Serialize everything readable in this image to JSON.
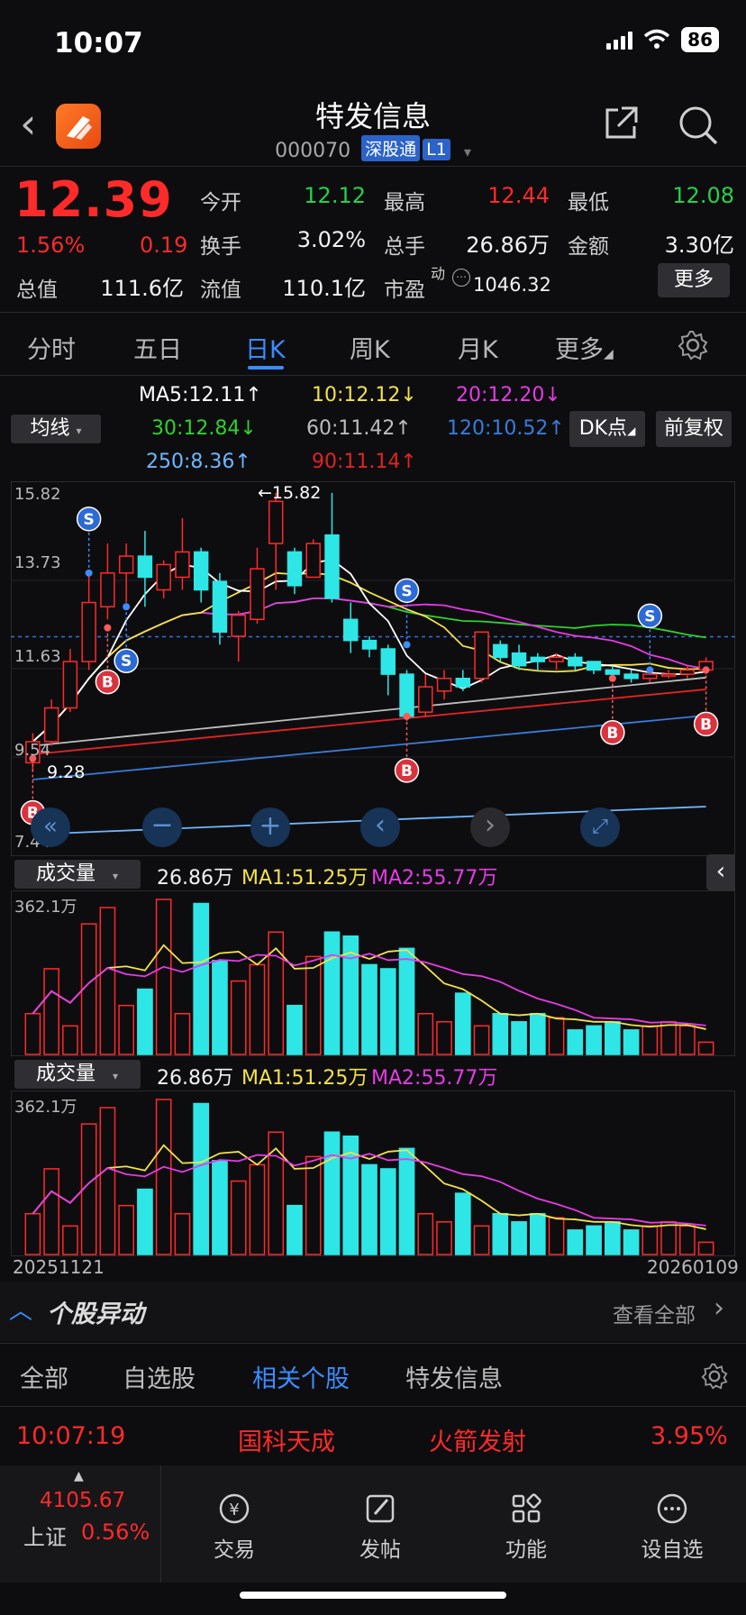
{
  "status": {
    "time": "10:07",
    "battery": "86"
  },
  "header": {
    "title": "特发信息",
    "code": "000070",
    "tag1": "深股通",
    "tag2": "L1"
  },
  "quote": {
    "price": "12.39",
    "change_pct": "1.56%",
    "change": "0.19",
    "open_label": "今开",
    "open": "12.12",
    "high_label": "最高",
    "high": "12.44",
    "low_label": "最低",
    "low": "12.08",
    "turnover_label": "换手",
    "turnover": "3.02%",
    "volume_label": "总手",
    "volume": "26.86万",
    "amount_label": "金额",
    "amount": "3.30亿",
    "mktcap_label": "总值",
    "mktcap": "111.6亿",
    "float_label": "流值",
    "float": "110.1亿",
    "pe_label": "市盈",
    "pe_sup": "动",
    "pe": "1046.32",
    "more_label": "更多"
  },
  "tabs": [
    "分时",
    "五日",
    "日K",
    "周K",
    "月K",
    "更多"
  ],
  "ma_legend": {
    "selector": "均线",
    "ma5": "MA5:12.11↑",
    "ma10": "10:12.12↓",
    "ma20": "20:12.20↓",
    "ma30": "30:12.84↓",
    "ma60": "60:11.42↑",
    "ma120": "120:10.52↑",
    "ma250": "250:8.36↑",
    "ma90": "90:11.14↑",
    "dk_label": "DK点",
    "fq_label": "前复权"
  },
  "kline": {
    "y_labels": [
      "15.82",
      "13.73",
      "11.63",
      "9.54",
      "7.44"
    ],
    "max_label": "←15.82",
    "min_label": "9.28",
    "marker_b": "B",
    "marker_s": "S"
  },
  "volume1": {
    "selector": "成交量",
    "value": "26.86万",
    "ma1": "MA1:51.25万",
    "ma2": "MA2:55.77万",
    "top_label": "362.1万"
  },
  "volume2": {
    "selector": "成交量",
    "value": "26.86万",
    "ma1": "MA1:51.25万",
    "ma2": "MA2:55.77万",
    "top_label": "362.1万",
    "date_start": "20251121",
    "date_end": "20260109"
  },
  "abnormal": {
    "title": "个股异动",
    "view_all": "查看全部"
  },
  "sub_tabs": [
    "全部",
    "自选股",
    "相关个股",
    "特发信息"
  ],
  "alert": {
    "time": "10:07:19",
    "stock": "国科天成",
    "event": "火箭发射",
    "pct": "3.95%"
  },
  "bottom_bar": {
    "index_value": "4105.67",
    "index_name": "上证",
    "index_pct": "0.56%",
    "items": [
      "交易",
      "发帖",
      "功能",
      "设自选"
    ]
  },
  "colors": {
    "up": "#ff2a2a",
    "down": "#26d14b",
    "accent": "#3b8cff",
    "candle_down": "#2ee6e6",
    "ma5": "#ffffff",
    "ma10": "#f2e24a",
    "ma20": "#e63be6",
    "ma30": "#2fd12f",
    "ma60": "#bdbdbd",
    "ma90": "#e02424",
    "ma120": "#3a7bd9",
    "ma250": "#6fb6ff"
  },
  "chart_data": {
    "type": "candlestick",
    "ylim": [
      7.44,
      15.82
    ],
    "candles": [
      [
        9.4,
        9.9,
        9.2,
        10.1
      ],
      [
        9.9,
        10.7,
        9.8,
        10.9
      ],
      [
        10.7,
        11.8,
        10.6,
        12.1
      ],
      [
        11.8,
        13.2,
        11.6,
        13.9
      ],
      [
        13.1,
        13.9,
        12.8,
        14.6
      ],
      [
        13.9,
        14.3,
        13.2,
        14.6
      ],
      [
        14.3,
        13.8,
        13.1,
        14.9
      ],
      [
        13.5,
        14.1,
        13.3,
        14.2
      ],
      [
        13.8,
        14.4,
        13.5,
        15.2
      ],
      [
        14.4,
        13.5,
        13.2,
        14.5
      ],
      [
        13.7,
        12.5,
        12.2,
        13.9
      ],
      [
        12.4,
        12.9,
        11.8,
        13.0
      ],
      [
        12.8,
        14.0,
        12.7,
        14.5
      ],
      [
        14.6,
        15.6,
        13.5,
        15.8
      ],
      [
        14.4,
        13.6,
        13.4,
        14.5
      ],
      [
        13.8,
        14.6,
        13.8,
        14.7
      ],
      [
        14.8,
        13.3,
        13.2,
        15.8
      ],
      [
        12.8,
        12.3,
        12.0,
        13.2
      ],
      [
        12.3,
        12.1,
        11.9,
        12.4
      ],
      [
        12.1,
        11.5,
        11.0,
        12.2
      ],
      [
        11.5,
        10.5,
        10.4,
        11.6
      ],
      [
        10.6,
        11.2,
        10.5,
        11.5
      ],
      [
        11.1,
        11.4,
        10.9,
        11.6
      ],
      [
        11.4,
        11.2,
        11.1,
        11.6
      ],
      [
        11.4,
        12.5,
        11.3,
        12.5
      ],
      [
        12.2,
        11.9,
        11.8,
        12.3
      ],
      [
        12.0,
        11.7,
        11.6,
        12.2
      ],
      [
        11.9,
        11.8,
        11.6,
        12.0
      ],
      [
        11.8,
        11.9,
        11.6,
        12.0
      ],
      [
        11.9,
        11.7,
        11.6,
        12.0
      ],
      [
        11.8,
        11.6,
        11.5,
        11.8
      ],
      [
        11.6,
        11.5,
        11.4,
        11.7
      ],
      [
        11.5,
        11.4,
        11.3,
        11.6
      ],
      [
        11.4,
        11.5,
        11.3,
        11.6
      ],
      [
        11.5,
        11.5,
        11.4,
        11.6
      ],
      [
        11.5,
        11.6,
        11.4,
        11.7
      ],
      [
        11.6,
        11.8,
        11.5,
        11.9
      ]
    ],
    "volume": [
      1.0,
      2.1,
      0.7,
      3.2,
      3.6,
      1.2,
      1.6,
      3.8,
      1.0,
      3.7,
      2.3,
      1.8,
      2.2,
      3.0,
      1.2,
      2.4,
      3.0,
      2.9,
      2.2,
      2.1,
      2.6,
      1.0,
      0.8,
      1.5,
      0.7,
      1.0,
      0.8,
      1.0,
      0.9,
      0.6,
      0.7,
      0.8,
      0.6,
      0.7,
      0.8,
      0.7,
      0.3
    ]
  }
}
